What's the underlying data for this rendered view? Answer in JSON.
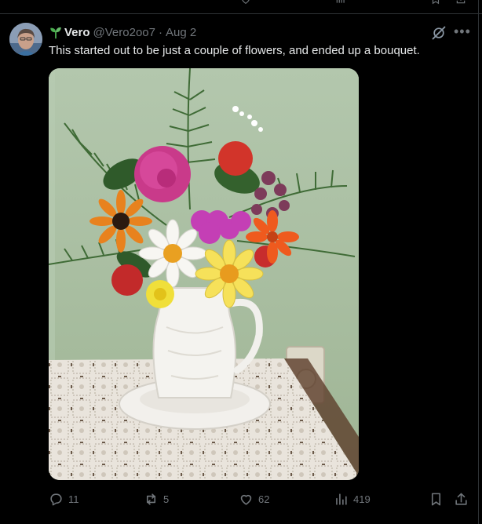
{
  "post": {
    "display_name": "Vero",
    "handle": "@Vero2oo7",
    "separator": "·",
    "date": "Aug 2",
    "text": "This started out to be just a couple of flowers, and ended up a bouquet.",
    "more_glyph": "•••"
  },
  "media": {
    "kind": "photo",
    "subject": "flowers-in-white-pitcher"
  },
  "actions": {
    "replies": "11",
    "reposts": "5",
    "likes": "62",
    "views": "419"
  },
  "icons": {
    "verified_sprout": "sprout-icon",
    "grok": "grok-icon",
    "reply": "reply-icon",
    "repost": "repost-icon",
    "like": "heart-icon",
    "views": "views-icon",
    "bookmark": "bookmark-icon",
    "share": "share-icon"
  },
  "colors": {
    "background": "#000000",
    "text_primary": "#e7e9ea",
    "text_secondary": "#71767b",
    "sprout_green": "#4caf50"
  }
}
